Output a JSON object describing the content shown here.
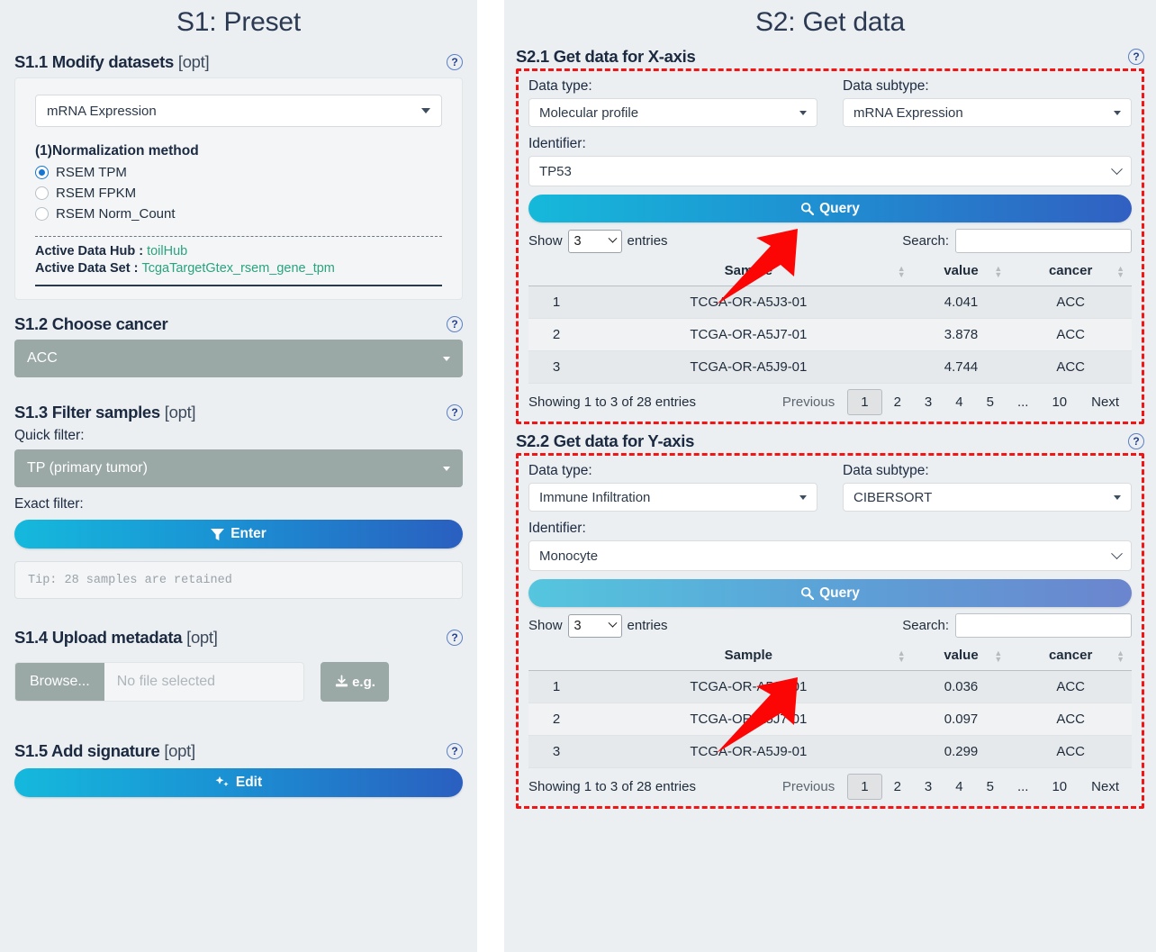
{
  "left": {
    "title": "S1: Preset",
    "s11": {
      "heading": "S1.1 Modify datasets",
      "opt": " [opt]",
      "dataset_select": "mRNA Expression",
      "norm_title": "(1)Normalization method",
      "radios": [
        {
          "label": "RSEM TPM",
          "selected": true
        },
        {
          "label": "RSEM FPKM",
          "selected": false
        },
        {
          "label": "RSEM Norm_Count",
          "selected": false
        }
      ],
      "hub_key": "Active Data Hub : ",
      "hub_value": "toilHub",
      "set_key": "Active Data Set : ",
      "set_value": "TcgaTargetGtex_rsem_gene_tpm"
    },
    "s12": {
      "heading": "S1.2 Choose cancer",
      "cancer_select": "ACC"
    },
    "s13": {
      "heading": "S1.3 Filter samples",
      "opt": " [opt]",
      "quick_filter_label": "Quick filter:",
      "quick_filter_value": "TP (primary tumor)",
      "exact_filter_label": "Exact filter:",
      "enter_button": "Enter",
      "tip": "Tip: 28 samples are retained"
    },
    "s14": {
      "heading": "S1.4 Upload metadata",
      "opt": " [opt]",
      "browse_button": "Browse...",
      "file_placeholder": "No file selected",
      "eg_button": "e.g."
    },
    "s15": {
      "heading": "S1.5 Add signature",
      "opt": " [opt]",
      "edit_button": "Edit"
    }
  },
  "right": {
    "title": "S2: Get data",
    "s21": {
      "heading": "S2.1 Get data for X-axis",
      "data_type_label": "Data type:",
      "data_type_value": "Molecular profile",
      "data_subtype_label": "Data subtype:",
      "data_subtype_value": "mRNA Expression",
      "identifier_label": "Identifier:",
      "identifier_value": "TP53",
      "query_button": "Query",
      "table": {
        "show_label": "Show",
        "entries_label": "entries",
        "page_length": "3",
        "search_label": "Search:",
        "search_value": "",
        "search_placeholder": "",
        "headers": [
          "",
          "Sample",
          "value",
          "cancer"
        ],
        "rows": [
          [
            "1",
            "TCGA-OR-A5J3-01",
            "4.041",
            "ACC"
          ],
          [
            "2",
            "TCGA-OR-A5J7-01",
            "3.878",
            "ACC"
          ],
          [
            "3",
            "TCGA-OR-A5J9-01",
            "4.744",
            "ACC"
          ]
        ],
        "info": "Showing 1 to 3 of 28 entries",
        "previous": "Previous",
        "pages": [
          "1",
          "2",
          "3",
          "4",
          "5",
          "...",
          "10"
        ],
        "current_page": "1",
        "next": "Next"
      }
    },
    "s22": {
      "heading": "S2.2 Get data for Y-axis",
      "data_type_label": "Data type:",
      "data_type_value": "Immune Infiltration",
      "data_subtype_label": "Data subtype:",
      "data_subtype_value": "CIBERSORT",
      "identifier_label": "Identifier:",
      "identifier_value": "Monocyte",
      "query_button": "Query",
      "table": {
        "show_label": "Show",
        "entries_label": "entries",
        "page_length": "3",
        "search_label": "Search:",
        "search_value": "",
        "search_placeholder": "",
        "headers": [
          "",
          "Sample",
          "value",
          "cancer"
        ],
        "rows": [
          [
            "1",
            "TCGA-OR-A5J3-01",
            "0.036",
            "ACC"
          ],
          [
            "2",
            "TCGA-OR-A5J7-01",
            "0.097",
            "ACC"
          ],
          [
            "3",
            "TCGA-OR-A5J9-01",
            "0.299",
            "ACC"
          ]
        ],
        "info": "Showing 1 to 3 of 28 entries",
        "previous": "Previous",
        "pages": [
          "1",
          "2",
          "3",
          "4",
          "5",
          "...",
          "10"
        ],
        "current_page": "1",
        "next": "Next"
      }
    }
  },
  "colors": {
    "page_bg": "#eceff1",
    "accent_gradient_start": "#15b9dc",
    "accent_gradient_end": "#2a5fc0",
    "annotation_red": "#f21515",
    "link_green": "#2aa37f",
    "gray_control": "#9aa8a6"
  },
  "help_icon": "?"
}
